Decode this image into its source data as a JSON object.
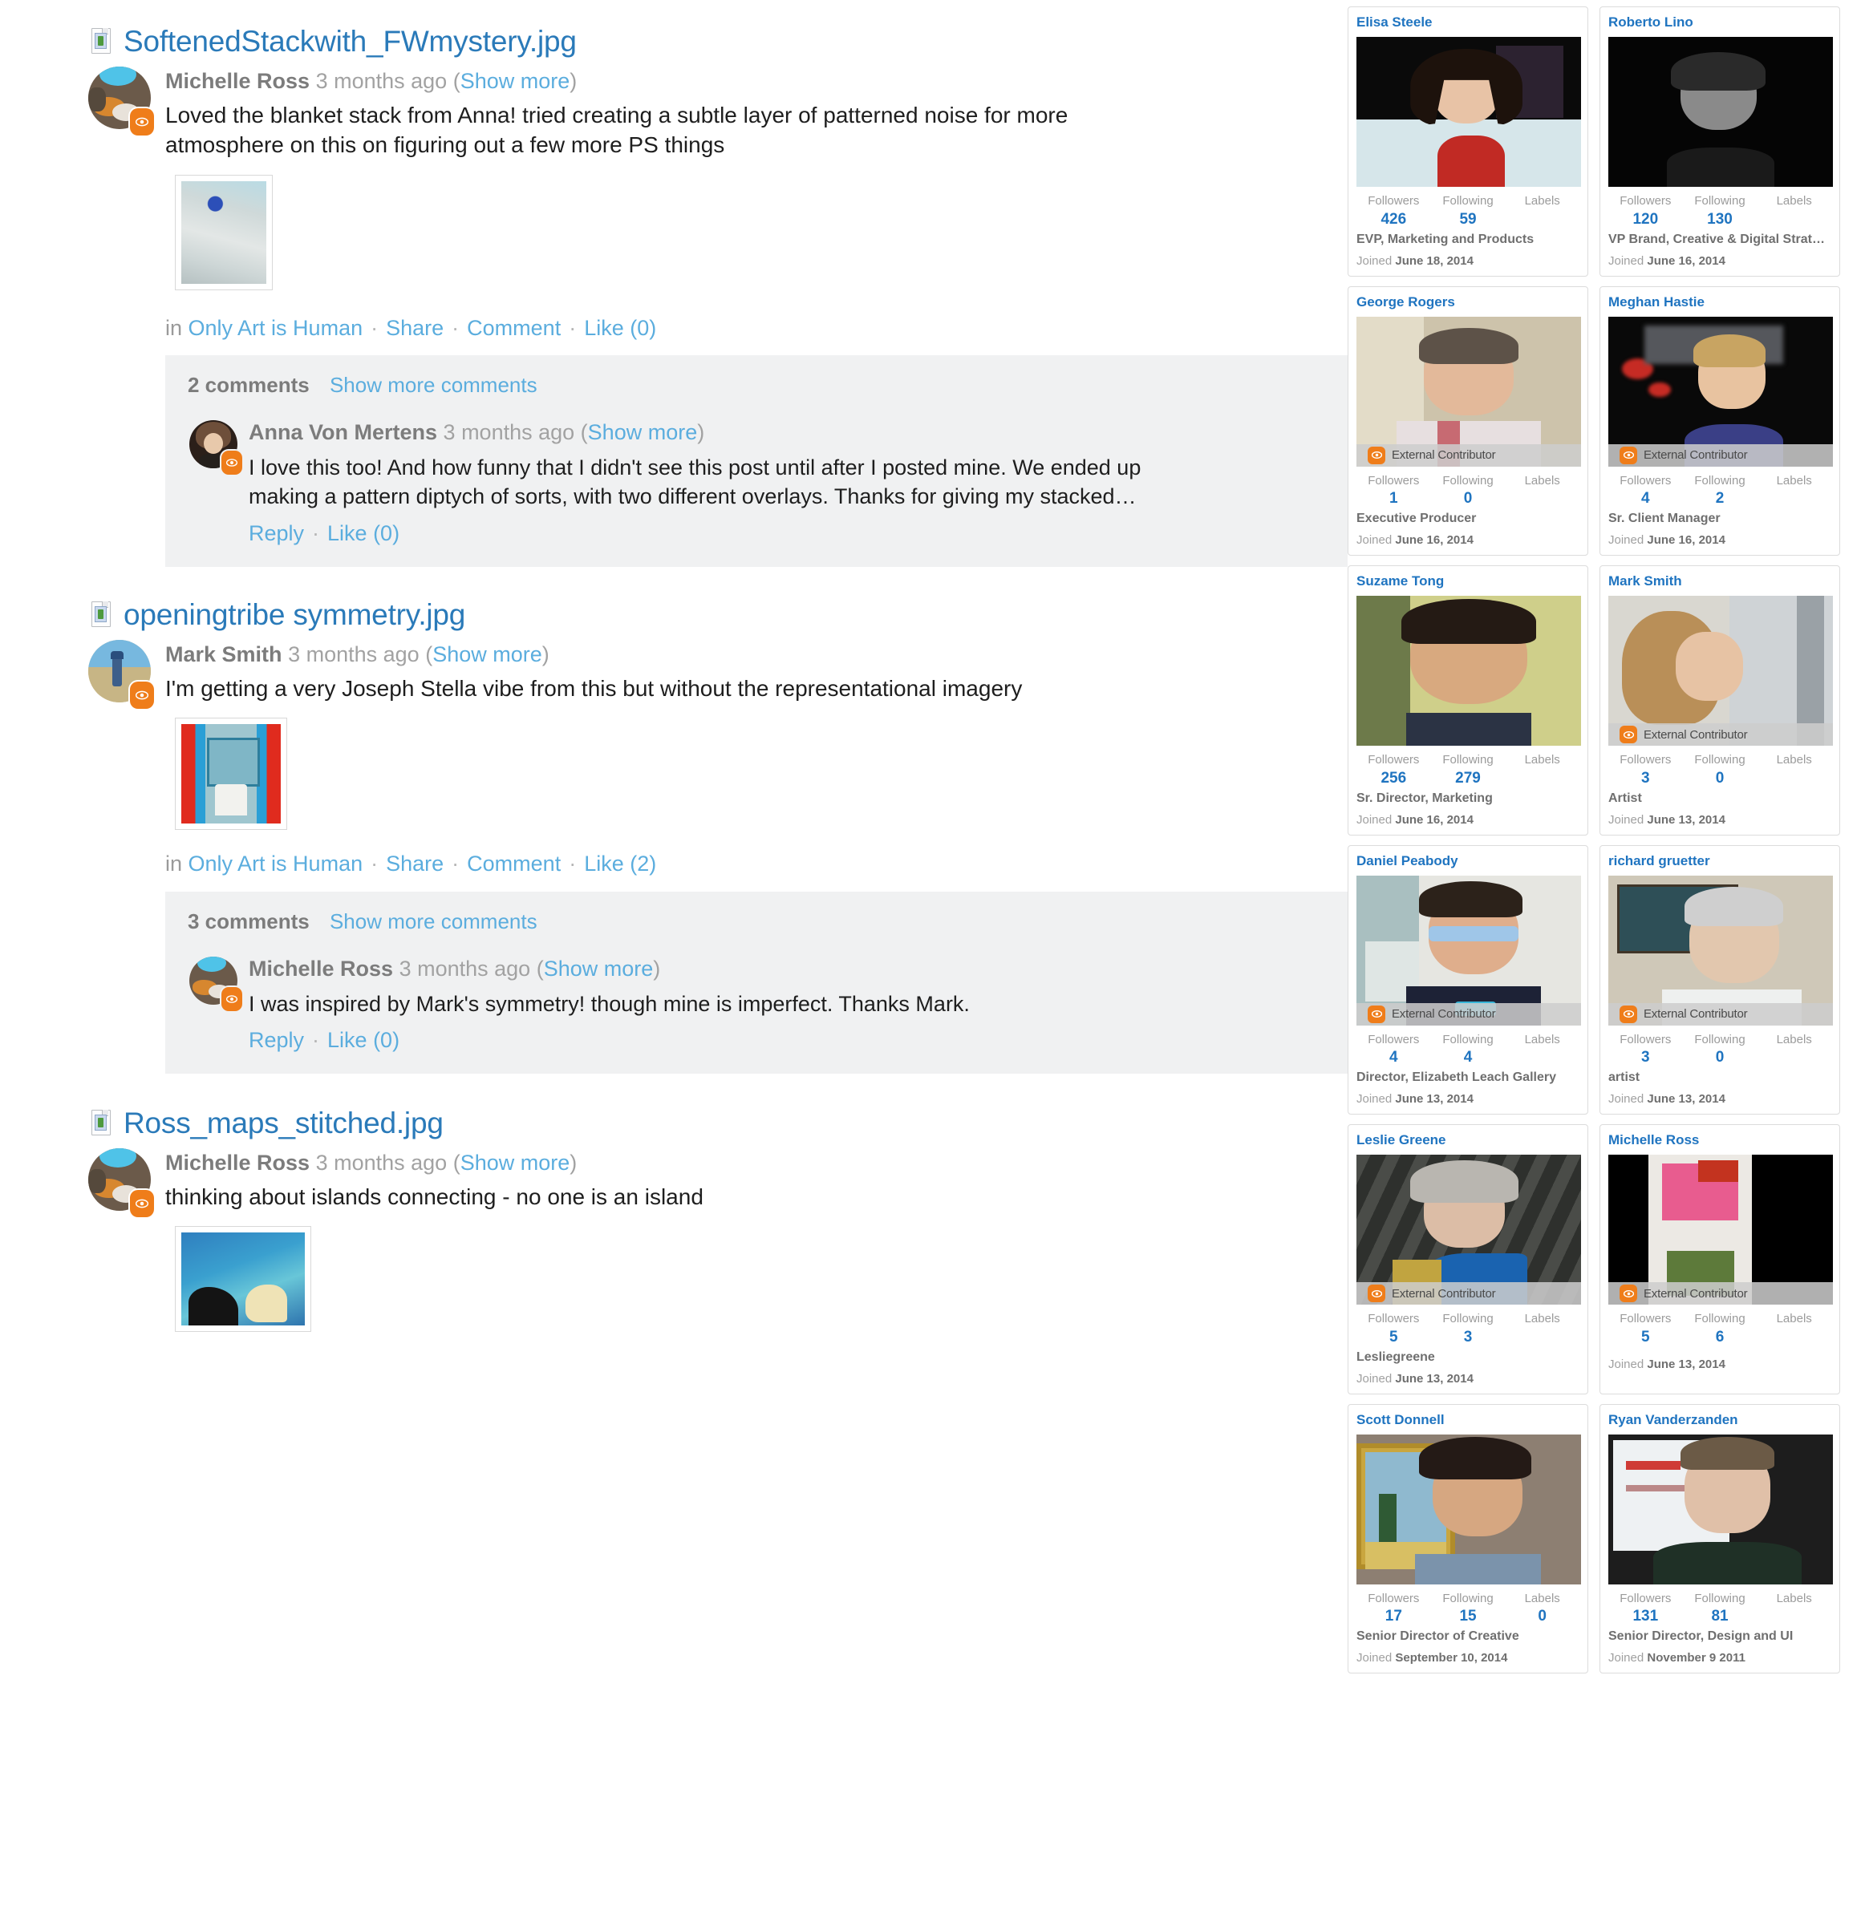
{
  "feed": {
    "posts": [
      {
        "filename": "SoftenedStackwith_FWmystery.jpg",
        "file_icon": "image-document-icon",
        "author": "Michelle Ross",
        "time": "3 months ago",
        "show_more": "Show more",
        "text": "Loved the blanket stack from Anna! tried creating a subtle layer of patterned noise for more atmosphere on this on figuring out a few more PS things",
        "actions": {
          "in_label": "in",
          "group": "Only Art is Human",
          "share": "Share",
          "comment": "Comment",
          "like": "Like (0)",
          "separator": "·"
        },
        "comments_header": {
          "count_label": "2 comments",
          "show_more": "Show more comments"
        },
        "comments": [
          {
            "author": "Anna Von Mertens",
            "time": "3 months ago",
            "show_more": "Show more",
            "text": "I love this too! And how funny that I didn't see this post until after I posted mine. We ended up making a pattern diptych of sorts, with two different overlays. Thanks for giving my stacked…",
            "reply": "Reply",
            "like": "Like (0)"
          }
        ]
      },
      {
        "filename": "openingtribe symmetry.jpg",
        "file_icon": "image-document-icon",
        "author": "Mark Smith",
        "time": "3 months ago",
        "show_more": "Show more",
        "text": "I'm getting a very Joseph Stella vibe from this but without the representational imagery",
        "actions": {
          "in_label": "in",
          "group": "Only Art is Human",
          "share": "Share",
          "comment": "Comment",
          "like": "Like (2)",
          "separator": "·"
        },
        "comments_header": {
          "count_label": "3 comments",
          "show_more": "Show more comments"
        },
        "comments": [
          {
            "author": "Michelle Ross",
            "time": "3 months ago",
            "show_more": "Show more",
            "text": "I was inspired by Mark's symmetry! though mine is imperfect. Thanks Mark.",
            "reply": "Reply",
            "like": "Like (0)"
          }
        ]
      },
      {
        "filename": "Ross_maps_stitched.jpg",
        "file_icon": "image-document-icon",
        "author": "Michelle Ross",
        "time": "3 months ago",
        "show_more": "Show more",
        "text": "thinking about islands connecting - no one is an island",
        "actions": null,
        "comments_header": null,
        "comments": []
      }
    ]
  },
  "sidebar": {
    "stat_labels": {
      "followers": "Followers",
      "following": "Following",
      "labels": "Labels"
    },
    "joined_prefix": "Joined",
    "external_badge": "External Contributor",
    "cards": [
      {
        "name": "Elisa Steele",
        "followers": "426",
        "following": "59",
        "labels": "",
        "title": "EVP, Marketing and Products",
        "joined": "June 18, 2014",
        "external": false
      },
      {
        "name": "Roberto Lino",
        "followers": "120",
        "following": "130",
        "labels": "",
        "title": "VP Brand, Creative & Digital Strat…",
        "joined": "June 16, 2014",
        "external": false
      },
      {
        "name": "George Rogers",
        "followers": "1",
        "following": "0",
        "labels": "",
        "title": "Executive Producer",
        "joined": "June 16, 2014",
        "external": true
      },
      {
        "name": "Meghan Hastie",
        "followers": "4",
        "following": "2",
        "labels": "",
        "title": "Sr. Client Manager",
        "joined": "June 16, 2014",
        "external": true
      },
      {
        "name": "Suzame Tong",
        "followers": "256",
        "following": "279",
        "labels": "",
        "title": "Sr. Director, Marketing",
        "joined": "June 16, 2014",
        "external": false
      },
      {
        "name": "Mark Smith",
        "followers": "3",
        "following": "0",
        "labels": "",
        "title": "Artist",
        "joined": "June 13, 2014",
        "external": true
      },
      {
        "name": "Daniel Peabody",
        "followers": "4",
        "following": "4",
        "labels": "",
        "title": "Director, Elizabeth Leach Gallery",
        "joined": "June 13, 2014",
        "external": true
      },
      {
        "name": "richard gruetter",
        "followers": "3",
        "following": "0",
        "labels": "",
        "title": "artist",
        "joined": "June 13, 2014",
        "external": true
      },
      {
        "name": "Leslie Greene",
        "followers": "5",
        "following": "3",
        "labels": "",
        "title": "Lesliegreene",
        "joined": "June 13, 2014",
        "external": true
      },
      {
        "name": "Michelle Ross",
        "followers": "5",
        "following": "6",
        "labels": "",
        "title": "",
        "joined": "June 13, 2014",
        "external": true
      },
      {
        "name": "Scott Donnell",
        "followers": "17",
        "following": "15",
        "labels": "0",
        "title": "Senior Director of Creative",
        "joined": "September 10, 2014",
        "external": false
      },
      {
        "name": "Ryan Vanderzanden",
        "followers": "131",
        "following": "81",
        "labels": "",
        "title": "Senior Director, Design and UI",
        "joined": "November 9 2011",
        "external": false
      }
    ]
  },
  "colors": {
    "link": "#5badde",
    "title_link": "#2a7ab9",
    "card_link": "#1f74c0",
    "badge_orange": "#ef7d1a",
    "comment_bg": "#f0f1f2"
  }
}
